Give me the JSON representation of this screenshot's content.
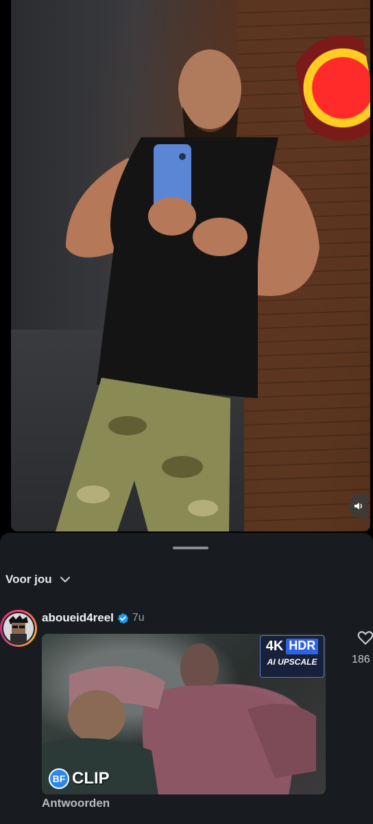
{
  "feed": {
    "label": "Voor jou",
    "chevron_icon": "chevron-down-icon"
  },
  "post": {
    "username": "aboueid4reel",
    "verified": true,
    "time": "7u",
    "like_count": "186",
    "reply_label": "Antwoorden",
    "thumbnail": {
      "badge_4k": "4K",
      "badge_hdr": "HDR",
      "badge_ai": "AI UPSCALE",
      "clip_logo": "BF",
      "clip_label": "CLIP"
    }
  },
  "colors": {
    "sheet_bg": "#181b20",
    "verified": "#1d9bf0",
    "hdr_blue": "#2e63e6"
  }
}
